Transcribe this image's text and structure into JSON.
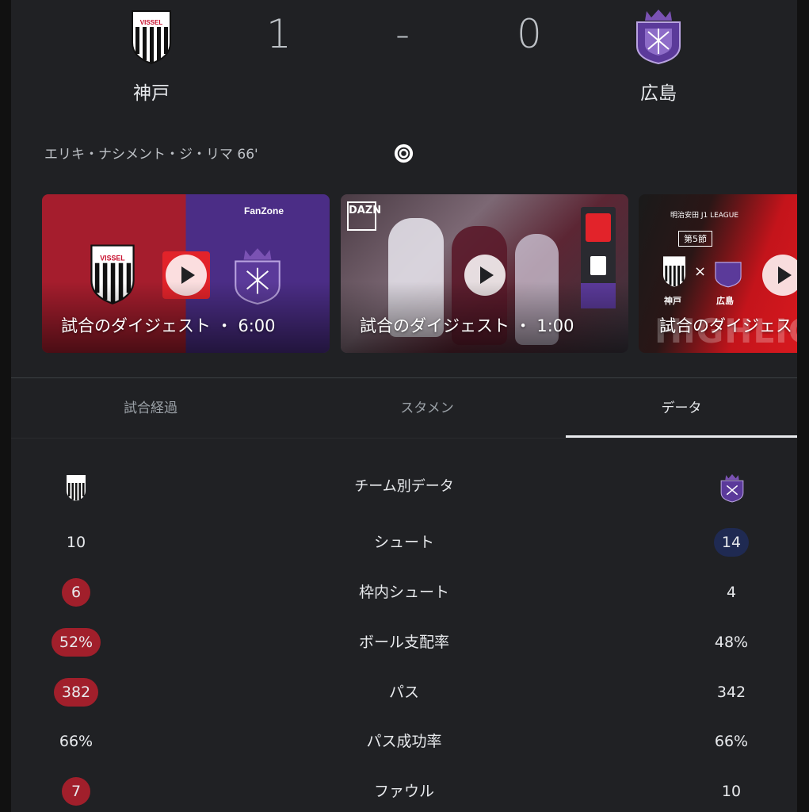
{
  "match": {
    "home_team": "神戸",
    "away_team": "広島",
    "home_score": "1",
    "separator": "-",
    "away_score": "0",
    "home_color": "#a51d2d",
    "away_color": "#4b2d86"
  },
  "goal_event": {
    "text": "エリキ・ナシメント・ジ・リマ 66'",
    "icon": "soccer-ball-icon"
  },
  "highlights": [
    {
      "caption": "試合のダイジェスト ・ 6:00",
      "badge": "FanZone"
    },
    {
      "caption": "試合のダイジェスト ・ 1:00",
      "badge": "DAZN",
      "badge_line2": "ZN"
    },
    {
      "caption": "試合のダイジェスト",
      "league": "明治安田 J1 LEAGUE",
      "round": "第5節",
      "home": "神戸",
      "away": "広島",
      "overlay": "HIGHLIGHTS"
    }
  ],
  "tabs": [
    {
      "label": "試合経過",
      "active": false
    },
    {
      "label": "スタメン",
      "active": false
    },
    {
      "label": "データ",
      "active": true
    }
  ],
  "stats": {
    "header": "チーム別データ",
    "rows": [
      {
        "label": "シュート",
        "home": "10",
        "away": "14",
        "leader": "away"
      },
      {
        "label": "枠内シュート",
        "home": "6",
        "away": "4",
        "leader": "home"
      },
      {
        "label": "ボール支配率",
        "home": "52%",
        "away": "48%",
        "leader": "home"
      },
      {
        "label": "パス",
        "home": "382",
        "away": "342",
        "leader": "home"
      },
      {
        "label": "パス成功率",
        "home": "66%",
        "away": "66%",
        "leader": "none"
      },
      {
        "label": "ファウル",
        "home": "7",
        "away": "10",
        "leader": "home"
      }
    ]
  }
}
